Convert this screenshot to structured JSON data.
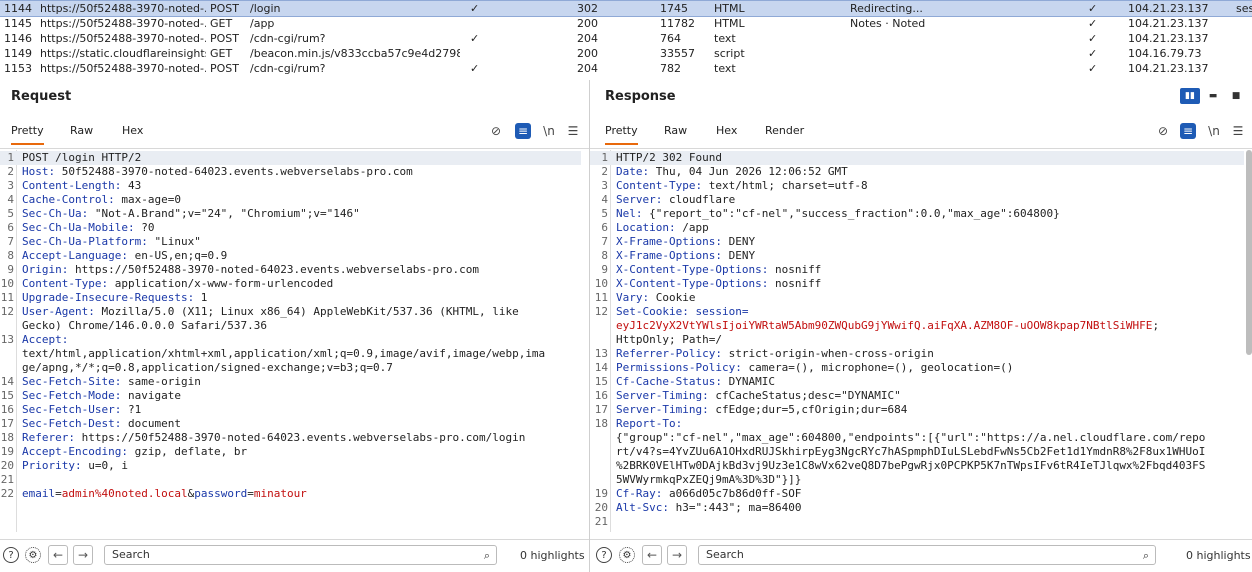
{
  "history": [
    {
      "id": "1144",
      "url": "https://50f52488-3970-noted-...",
      "method": "POST",
      "path": "/login",
      "params": "✓",
      "status": "302",
      "length": "1745",
      "mime": "HTML",
      "title": "Redirecting...",
      "tls": "✓",
      "ip": "104.21.23.137",
      "cookie": "ses",
      "selected": true
    },
    {
      "id": "1145",
      "url": "https://50f52488-3970-noted-...",
      "method": "GET",
      "path": "/app",
      "params": "",
      "status": "200",
      "length": "11782",
      "mime": "HTML",
      "title": "Notes · Noted",
      "tls": "✓",
      "ip": "104.21.23.137",
      "cookie": "",
      "selected": false
    },
    {
      "id": "1146",
      "url": "https://50f52488-3970-noted-...",
      "method": "POST",
      "path": "/cdn-cgi/rum?",
      "params": "✓",
      "status": "204",
      "length": "764",
      "mime": "text",
      "title": "",
      "tls": "✓",
      "ip": "104.21.23.137",
      "cookie": "",
      "selected": false
    },
    {
      "id": "1149",
      "url": "https://static.cloudflareinsights....",
      "method": "GET",
      "path": "/beacon.min.js/v833ccba57c9e4d2798...",
      "params": "",
      "status": "200",
      "length": "33557",
      "mime": "script",
      "title": "",
      "tls": "✓",
      "ip": "104.16.79.73",
      "cookie": "",
      "selected": false
    },
    {
      "id": "1153",
      "url": "https://50f52488-3970-noted-...",
      "method": "POST",
      "path": "/cdn-cgi/rum?",
      "params": "✓",
      "status": "204",
      "length": "782",
      "mime": "text",
      "title": "",
      "tls": "✓",
      "ip": "104.21.23.137",
      "cookie": "",
      "selected": false
    }
  ],
  "request": {
    "title": "Request",
    "tabs": [
      "Pretty",
      "Raw",
      "Hex"
    ],
    "newline_label": "\\n",
    "lines": [
      {
        "n": "1",
        "t": "POST /login HTTP/2"
      },
      {
        "n": "2",
        "k": "Host:",
        "t": " 50f52488-3970-noted-64023.events.webverselabs-pro.com"
      },
      {
        "n": "3",
        "k": "Content-Length:",
        "t": " 43"
      },
      {
        "n": "4",
        "k": "Cache-Control:",
        "t": " max-age=0"
      },
      {
        "n": "5",
        "k": "Sec-Ch-Ua:",
        "t": " \"Not-A.Brand\";v=\"24\", \"Chromium\";v=\"146\""
      },
      {
        "n": "6",
        "k": "Sec-Ch-Ua-Mobile:",
        "t": " ?0"
      },
      {
        "n": "7",
        "k": "Sec-Ch-Ua-Platform:",
        "t": " \"Linux\""
      },
      {
        "n": "8",
        "k": "Accept-Language:",
        "t": " en-US,en;q=0.9"
      },
      {
        "n": "9",
        "k": "Origin:",
        "t": " https://50f52488-3970-noted-64023.events.webverselabs-pro.com"
      },
      {
        "n": "10",
        "k": "Content-Type:",
        "t": " application/x-www-form-urlencoded"
      },
      {
        "n": "11",
        "k": "Upgrade-Insecure-Requests:",
        "t": " 1"
      },
      {
        "n": "12",
        "k": "User-Agent:",
        "t": " Mozilla/5.0 (X11; Linux x86_64) AppleWebKit/537.36 (KHTML, like\nGecko) Chrome/146.0.0.0 Safari/537.36"
      },
      {
        "n": "13",
        "k": "Accept:",
        "t": "\ntext/html,application/xhtml+xml,application/xml;q=0.9,image/avif,image/webp,ima\nge/apng,*/*;q=0.8,application/signed-exchange;v=b3;q=0.7"
      },
      {
        "n": "14",
        "k": "Sec-Fetch-Site:",
        "t": " same-origin"
      },
      {
        "n": "15",
        "k": "Sec-Fetch-Mode:",
        "t": " navigate"
      },
      {
        "n": "16",
        "k": "Sec-Fetch-User:",
        "t": " ?1"
      },
      {
        "n": "17",
        "k": "Sec-Fetch-Dest:",
        "t": " document"
      },
      {
        "n": "18",
        "k": "Referer:",
        "t": " https://50f52488-3970-noted-64023.events.webverselabs-pro.com/login"
      },
      {
        "n": "19",
        "k": "Accept-Encoding:",
        "t": " gzip, deflate, br"
      },
      {
        "n": "20",
        "k": "Priority:",
        "t": " u=0, i"
      },
      {
        "n": "21",
        "t": ""
      },
      {
        "n": "22",
        "body": [
          {
            "k": "email"
          },
          {
            "t": "="
          },
          {
            "v": "admin%40noted.local"
          },
          {
            "t": "&"
          },
          {
            "k": "password"
          },
          {
            "t": "="
          },
          {
            "v": "minatour"
          }
        ]
      }
    ],
    "search_placeholder": "Search",
    "highlights": "0 highlights"
  },
  "response": {
    "title": "Response",
    "tabs": [
      "Pretty",
      "Raw",
      "Hex",
      "Render"
    ],
    "newline_label": "\\n",
    "lines": [
      {
        "n": "1",
        "t": "HTTP/2 302 Found"
      },
      {
        "n": "2",
        "k": "Date:",
        "t": " Thu, 04 Jun 2026 12:06:52 GMT"
      },
      {
        "n": "3",
        "k": "Content-Type:",
        "t": " text/html; charset=utf-8"
      },
      {
        "n": "4",
        "k": "Server:",
        "t": " cloudflare"
      },
      {
        "n": "5",
        "k": "Nel:",
        "t": " {\"report_to\":\"cf-nel\",\"success_fraction\":0.0,\"max_age\":604800}"
      },
      {
        "n": "6",
        "k": "Location:",
        "t": " /app"
      },
      {
        "n": "7",
        "k": "X-Frame-Options:",
        "t": " DENY"
      },
      {
        "n": "8",
        "k": "X-Frame-Options:",
        "t": " DENY"
      },
      {
        "n": "9",
        "k": "X-Content-Type-Options:",
        "t": " nosniff"
      },
      {
        "n": "10",
        "k": "X-Content-Type-Options:",
        "t": " nosniff"
      },
      {
        "n": "11",
        "k": "Vary:",
        "t": " Cookie"
      },
      {
        "n": "12",
        "cookie": {
          "k": "Set-Cookie:",
          "ck": " session=",
          "cv": "eyJ1c2VyX2VtYWlsIjoiYWRtaW5Abm90ZWQubG9jYWwifQ.aiFqXA.AZM8OF-uOOW8kpap7NBtlSiWHFE",
          "tail": ";\nHttpOnly; Path=/"
        }
      },
      {
        "n": "13",
        "k": "Referrer-Policy:",
        "t": " strict-origin-when-cross-origin"
      },
      {
        "n": "14",
        "k": "Permissions-Policy:",
        "t": " camera=(), microphone=(), geolocation=()"
      },
      {
        "n": "15",
        "k": "Cf-Cache-Status:",
        "t": " DYNAMIC"
      },
      {
        "n": "16",
        "k": "Server-Timing:",
        "t": " cfCacheStatus;desc=\"DYNAMIC\""
      },
      {
        "n": "17",
        "k": "Server-Timing:",
        "t": " cfEdge;dur=5,cfOrigin;dur=684"
      },
      {
        "n": "18",
        "k": "Report-To:",
        "t": "\n{\"group\":\"cf-nel\",\"max_age\":604800,\"endpoints\":[{\"url\":\"https://a.nel.cloudflare.com/repo\nrt/v4?s=4YvZUu6A1OHxdRUJSkhirpEyg3NgcRYc7hASpmphDIuLSLebdFwNs5Cb2Fet1d1YmdnR8%2F8ux1WHUoI\n%2BRK0VElHTw0DAjkBd3vj9Uz3e1C8wVx62veQ8D7bePgwRjx0PCPKP5K7nTWpsIFv6tR4IeTJlqwx%2Fbqd403FS\n5WVWyrmkqPxZEQj9mA%3D%3D\"}]}"
      },
      {
        "n": "19",
        "k": "Cf-Ray:",
        "t": " a066d05c7b86d0ff-SOF"
      },
      {
        "n": "20",
        "k": "Alt-Svc:",
        "t": " h3=\":443\"; ma=86400"
      },
      {
        "n": "21",
        "t": ""
      }
    ],
    "search_placeholder": "Search",
    "highlights": "0 highlights"
  },
  "colors": {
    "accent": "#e8690c",
    "keyword": "#1a38a8",
    "value": "#c20f0f",
    "selection": "#c7d6ef",
    "button": "#1e5bb5"
  }
}
